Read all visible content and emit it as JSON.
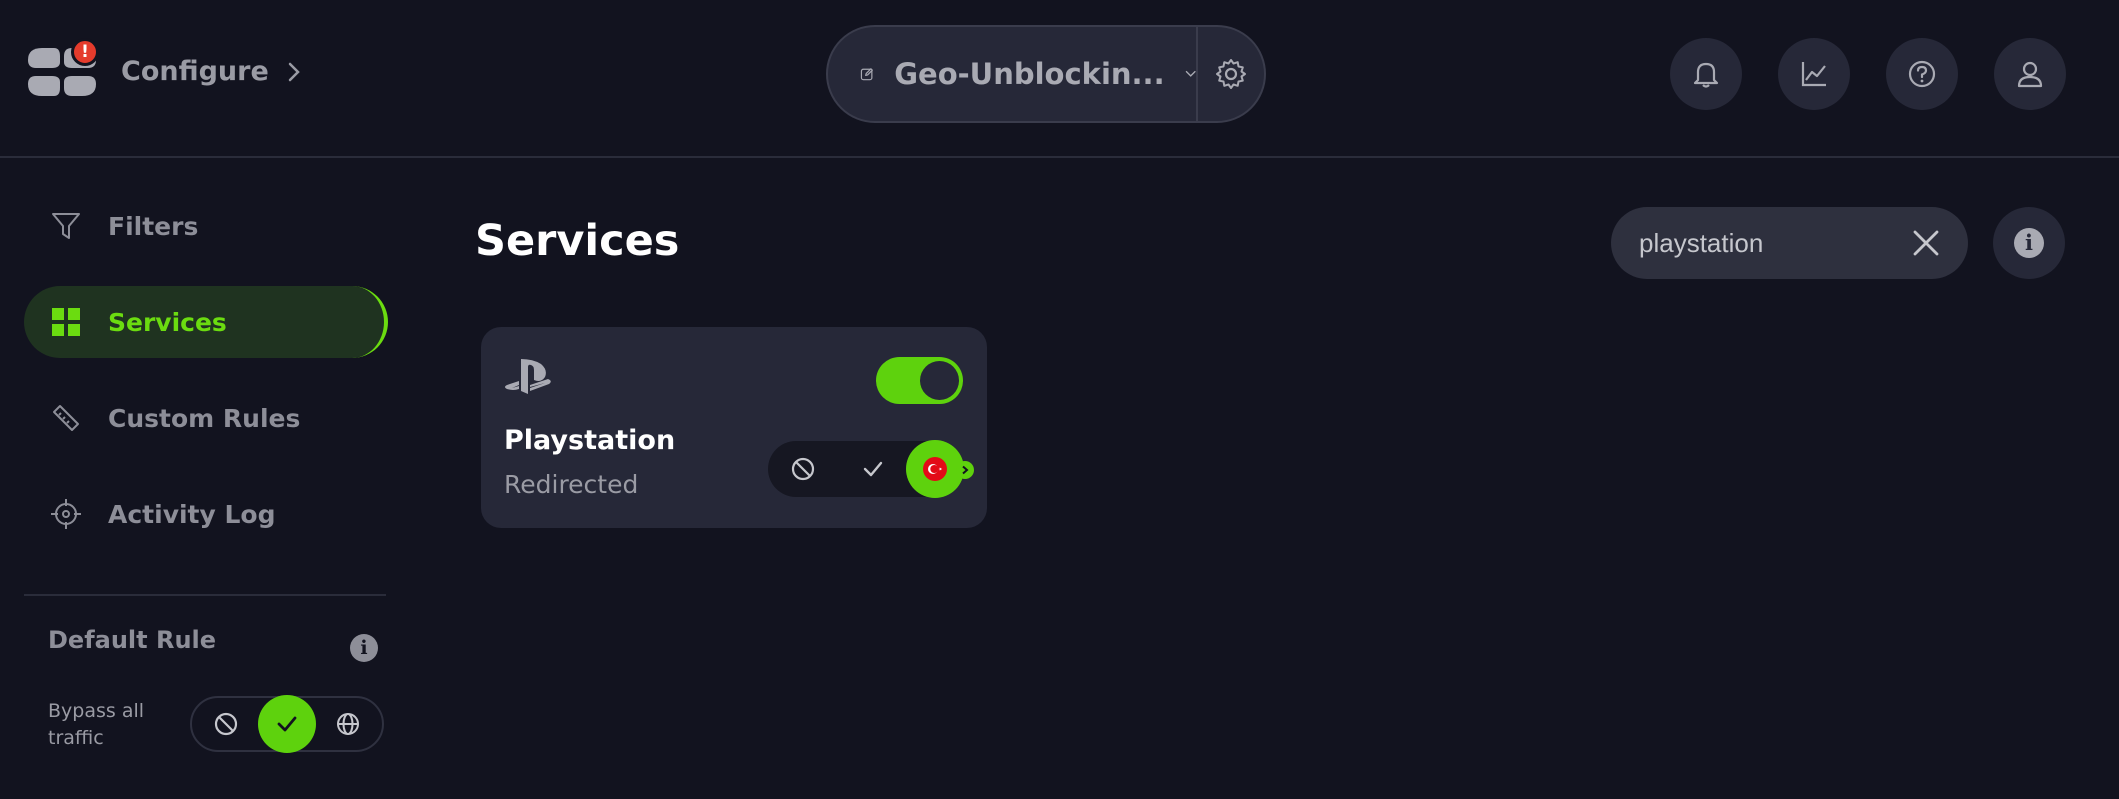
{
  "header": {
    "configure_label": "Configure",
    "profile_name": "Geo-Unblockin...",
    "alert_badge": "!"
  },
  "sidebar": {
    "items": [
      {
        "label": "Filters",
        "icon": "funnel-icon"
      },
      {
        "label": "Services",
        "icon": "grid-icon",
        "active": true
      },
      {
        "label": "Custom Rules",
        "icon": "ruler-icon"
      },
      {
        "label": "Activity Log",
        "icon": "crosshair-icon"
      }
    ],
    "default_rule_title": "Default Rule",
    "bypass_label": "Bypass all traffic",
    "default_rule_selected": "allow"
  },
  "main": {
    "title": "Services",
    "search": {
      "value": "playstation",
      "placeholder": ""
    },
    "services": [
      {
        "name": "Playstation",
        "status": "Redirected",
        "enabled": true,
        "mode": "redirect",
        "redirect_country": "Turkey"
      }
    ]
  },
  "colors": {
    "accent": "#5ed20d",
    "background": "#12131f",
    "panel": "#262838",
    "alert": "#e53b2c"
  }
}
